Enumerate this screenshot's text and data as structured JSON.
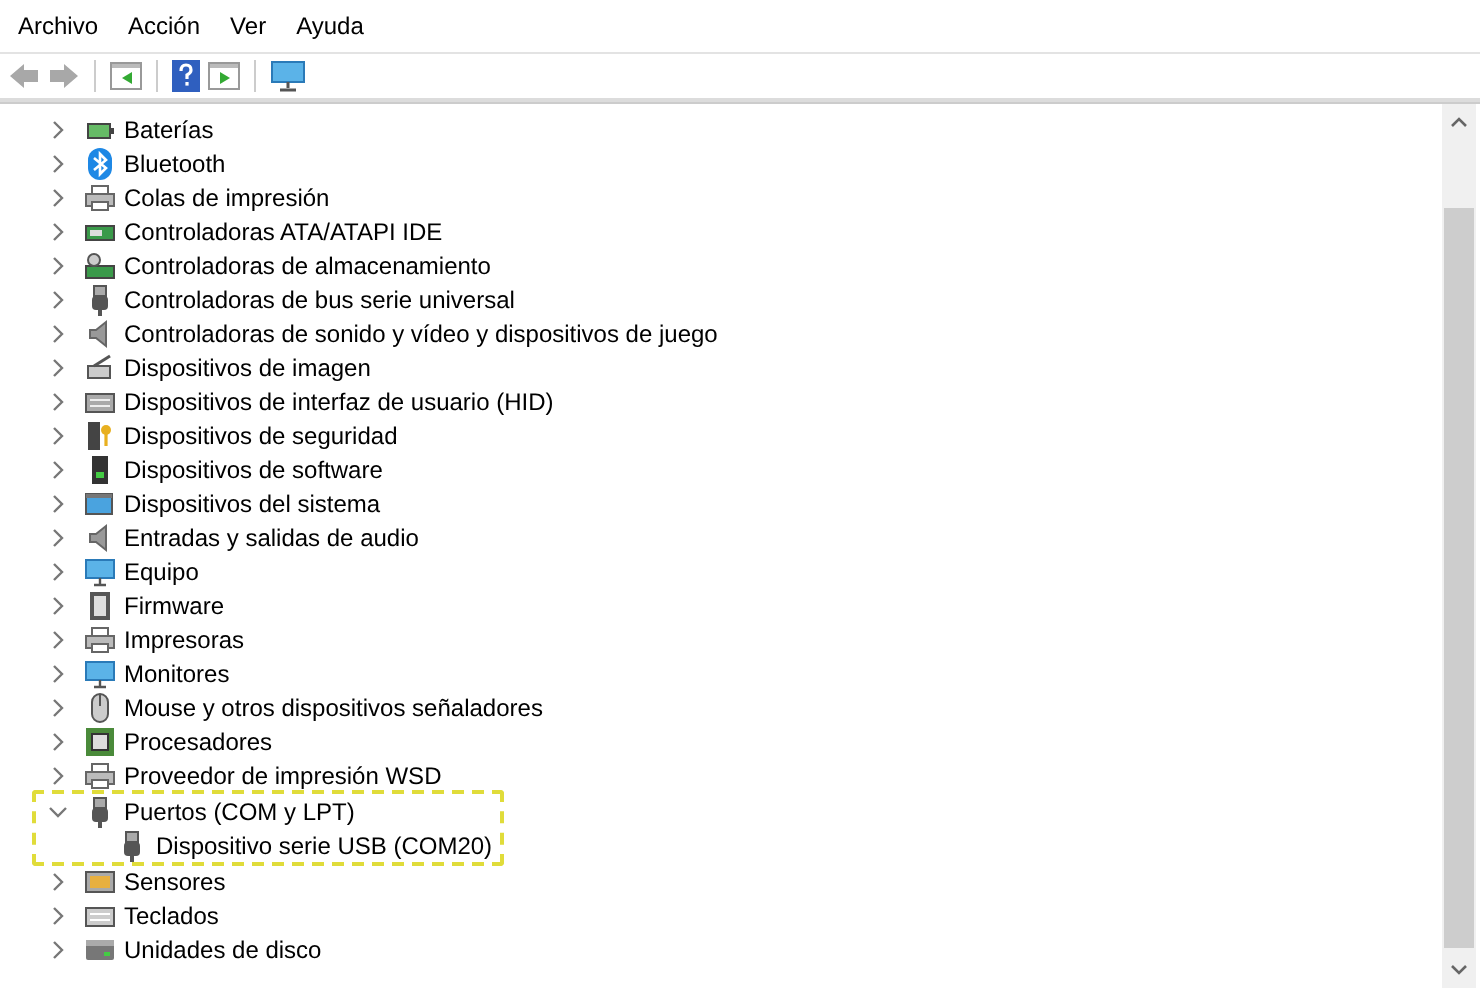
{
  "menu": [
    "Archivo",
    "Acción",
    "Ver",
    "Ayuda"
  ],
  "tree": [
    {
      "label": "Baterías",
      "expanded": false
    },
    {
      "label": "Bluetooth",
      "expanded": false
    },
    {
      "label": "Colas de impresión",
      "expanded": false
    },
    {
      "label": "Controladoras ATA/ATAPI IDE",
      "expanded": false
    },
    {
      "label": "Controladoras de almacenamiento",
      "expanded": false
    },
    {
      "label": "Controladoras de bus serie universal",
      "expanded": false
    },
    {
      "label": "Controladoras de sonido y vídeo y dispositivos de juego",
      "expanded": false
    },
    {
      "label": "Dispositivos de imagen",
      "expanded": false
    },
    {
      "label": "Dispositivos de interfaz de usuario (HID)",
      "expanded": false
    },
    {
      "label": "Dispositivos de seguridad",
      "expanded": false
    },
    {
      "label": "Dispositivos de software",
      "expanded": false
    },
    {
      "label": "Dispositivos del sistema",
      "expanded": false
    },
    {
      "label": "Entradas y salidas de audio",
      "expanded": false
    },
    {
      "label": "Equipo",
      "expanded": false
    },
    {
      "label": "Firmware",
      "expanded": false
    },
    {
      "label": "Impresoras",
      "expanded": false
    },
    {
      "label": "Monitores",
      "expanded": false
    },
    {
      "label": "Mouse y otros dispositivos señaladores",
      "expanded": false
    },
    {
      "label": "Procesadores",
      "expanded": false
    },
    {
      "label": "Proveedor de impresión WSD",
      "expanded": false
    },
    {
      "label": "Puertos (COM y LPT)",
      "expanded": true,
      "highlighted": true,
      "children": [
        {
          "label": "Dispositivo serie USB (COM20)"
        }
      ]
    },
    {
      "label": "Sensores",
      "expanded": false
    },
    {
      "label": "Teclados",
      "expanded": false
    },
    {
      "label": "Unidades de disco",
      "expanded": false
    }
  ]
}
